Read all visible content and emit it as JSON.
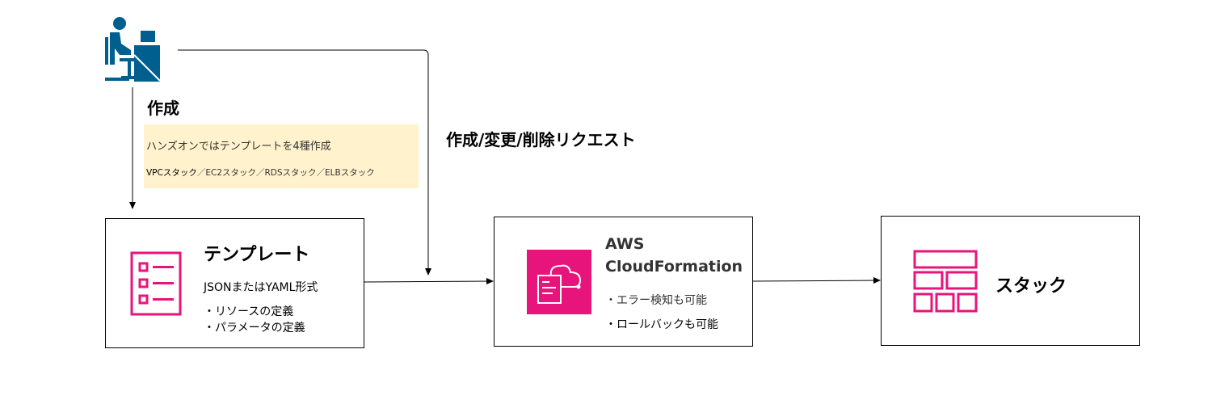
{
  "colors": {
    "accent": "#e7157b",
    "user_icon": "#005f8f",
    "note_bg": "#fff2cc"
  },
  "user": {
    "icon": "user-at-desk-icon",
    "label": "作成"
  },
  "note": {
    "line1": "ハンズオンではテンプレートを4種作成",
    "line2_prefix": "VPCスタック",
    "line2_rest": "／EC2スタック／RDSスタック／ELBスタック"
  },
  "request_label": "作成/変更/削除リクエスト",
  "template_box": {
    "icon": "checklist-icon",
    "title": "テンプレート",
    "format": "JSONまたはYAML形式",
    "bullets": [
      "・リソースの定義",
      "・パラメータの定義"
    ]
  },
  "cfn_box": {
    "icon": "cloudformation-icon",
    "title_line1": "AWS",
    "title_line2": "CloudFormation",
    "bullets": [
      "・エラー検知も可能",
      "・ロールバックも可能"
    ]
  },
  "stack_box": {
    "icon": "stack-grid-icon",
    "title": "スタック"
  }
}
